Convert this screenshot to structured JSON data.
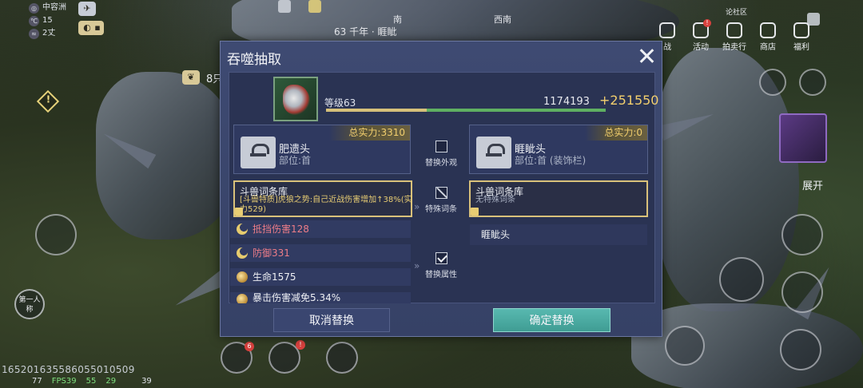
{
  "hud": {
    "location": "中容洲",
    "temperature": "15",
    "temperature_unit": "°C",
    "wind": "2丈",
    "follow_text": "8只"
  },
  "top": {
    "compass_south": "南",
    "compass_southwest": "西南",
    "time_info": "63 千年 · 睚眦",
    "community": "论社区",
    "menu": [
      {
        "label": "活动",
        "icon": "event-icon",
        "badge": "!"
      },
      {
        "label": "拍卖行",
        "icon": "auction-icon",
        "badge": ""
      },
      {
        "label": "商店",
        "icon": "shop-icon",
        "badge": ""
      },
      {
        "label": "福利",
        "icon": "gift-icon",
        "badge": ""
      }
    ],
    "partial_menu_label": "战"
  },
  "right": {
    "expand_label": "展开"
  },
  "left": {
    "first_person_label": "第一人称",
    "warning_symbol": "!"
  },
  "bottom": {
    "player_id": "1652016355860550105​09",
    "ping": "77",
    "fps": "FPS39",
    "network": "55",
    "battery": "29",
    "bag_count": "39",
    "skill_badge": "6",
    "skill_alert": "!"
  },
  "dialog": {
    "title": "吞噬抽取",
    "level_label": "等级63",
    "exp_value": "1174193",
    "exp_gain": "+251550",
    "exp_progress": 0.36,
    "source": {
      "power": "总实力:3310",
      "name": "肥遗头",
      "part": "部位:首"
    },
    "target": {
      "power": "总实力:0",
      "name": "睚眦头",
      "part": "部位:首 (装饰栏)"
    },
    "options": {
      "appearance": "替换外观",
      "special": "特殊词条",
      "attributes": "替换属性"
    },
    "source_affix": {
      "title": "斗兽词条库",
      "desc": "[斗兽特质]虎狼之势:自己近战伤害增加↑38%(实力529)"
    },
    "target_affix": {
      "title": "斗兽词条库",
      "desc": "无特殊词条"
    },
    "attributes": [
      {
        "label": "抵挡伤害128",
        "color": "red",
        "icon": "moon-icon"
      },
      {
        "label": "防御331",
        "color": "red",
        "icon": "moon-icon"
      },
      {
        "label": "生命1575",
        "color": "white",
        "icon": "orb-icon"
      },
      {
        "label": "暴击伤害减免5.34%",
        "color": "white",
        "icon": "orb-icon"
      }
    ],
    "target_attr": "睚眦头",
    "cancel_label": "取消替换",
    "confirm_label": "确定替换",
    "colors": {
      "gold": "#f2cf6e",
      "red_attr": "#ee7d88",
      "confirm": "#4fae a5"
    }
  }
}
